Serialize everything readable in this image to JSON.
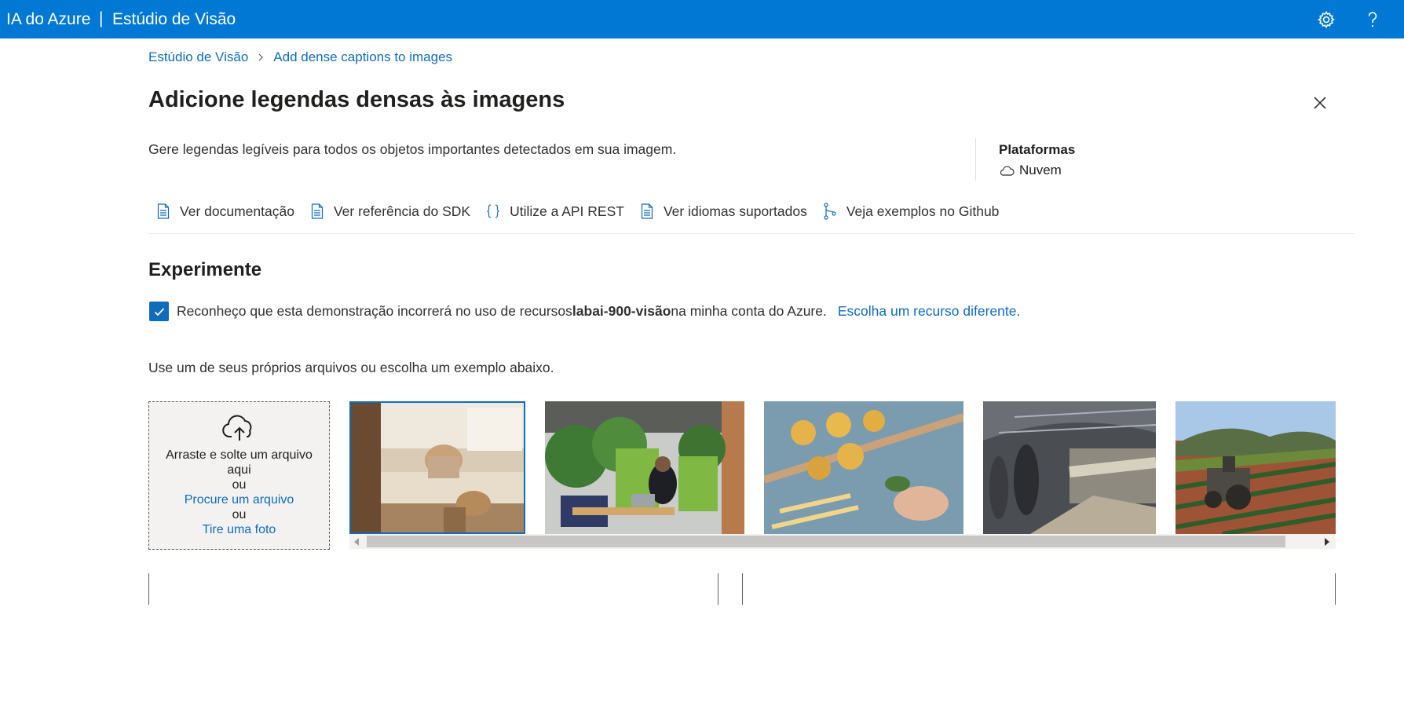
{
  "header": {
    "brand": "IA do Azure",
    "separator": "|",
    "product": "Estúdio de Visão",
    "settings_icon": "gear-icon",
    "help_icon": "question-icon",
    "bg_color": "#0078d4"
  },
  "breadcrumb": {
    "root": "Estúdio de Visão",
    "current": "Add dense captions to images"
  },
  "page": {
    "title": "Adicione legendas densas às imagens",
    "description": "Gere legendas legíveis para todos os objetos importantes detectados em sua imagem.",
    "platforms_label": "Plataformas",
    "platform_value": "Nuvem"
  },
  "links": [
    {
      "label": "Ver documentação",
      "icon": "document-icon"
    },
    {
      "label": "Ver referência do SDK",
      "icon": "document-icon"
    },
    {
      "label": "Utilize a API REST",
      "icon": "braces-icon"
    },
    {
      "label": "Ver idiomas suportados",
      "icon": "document-icon"
    },
    {
      "label": "Veja exemplos no Github",
      "icon": "branch-icon"
    }
  ],
  "experiment": {
    "title": "Experimente",
    "ack_prefix": "Reconheço que esta demonstração incorrerá no uso de recursos",
    "resource": "labai-900-visão",
    "ack_suffix": "na minha conta do Azure.",
    "change_resource": "Escolha um recurso diferente.",
    "checked": true,
    "use_text": "Use um de seus próprios arquivos ou escolha um exemplo abaixo."
  },
  "upload": {
    "drag_text": "Arraste e solte um arquivo aqui",
    "or1": "ou",
    "browse": "Procure um arquivo",
    "or2": "ou",
    "take_photo": "Tire uma foto"
  },
  "samples": [
    {
      "name": "woman-laptop-dog",
      "selected": true
    },
    {
      "name": "woman-office-laptop",
      "selected": false
    },
    {
      "name": "pasta-cooking",
      "selected": false
    },
    {
      "name": "subway-train",
      "selected": false
    },
    {
      "name": "tractor-farm",
      "selected": false
    }
  ]
}
